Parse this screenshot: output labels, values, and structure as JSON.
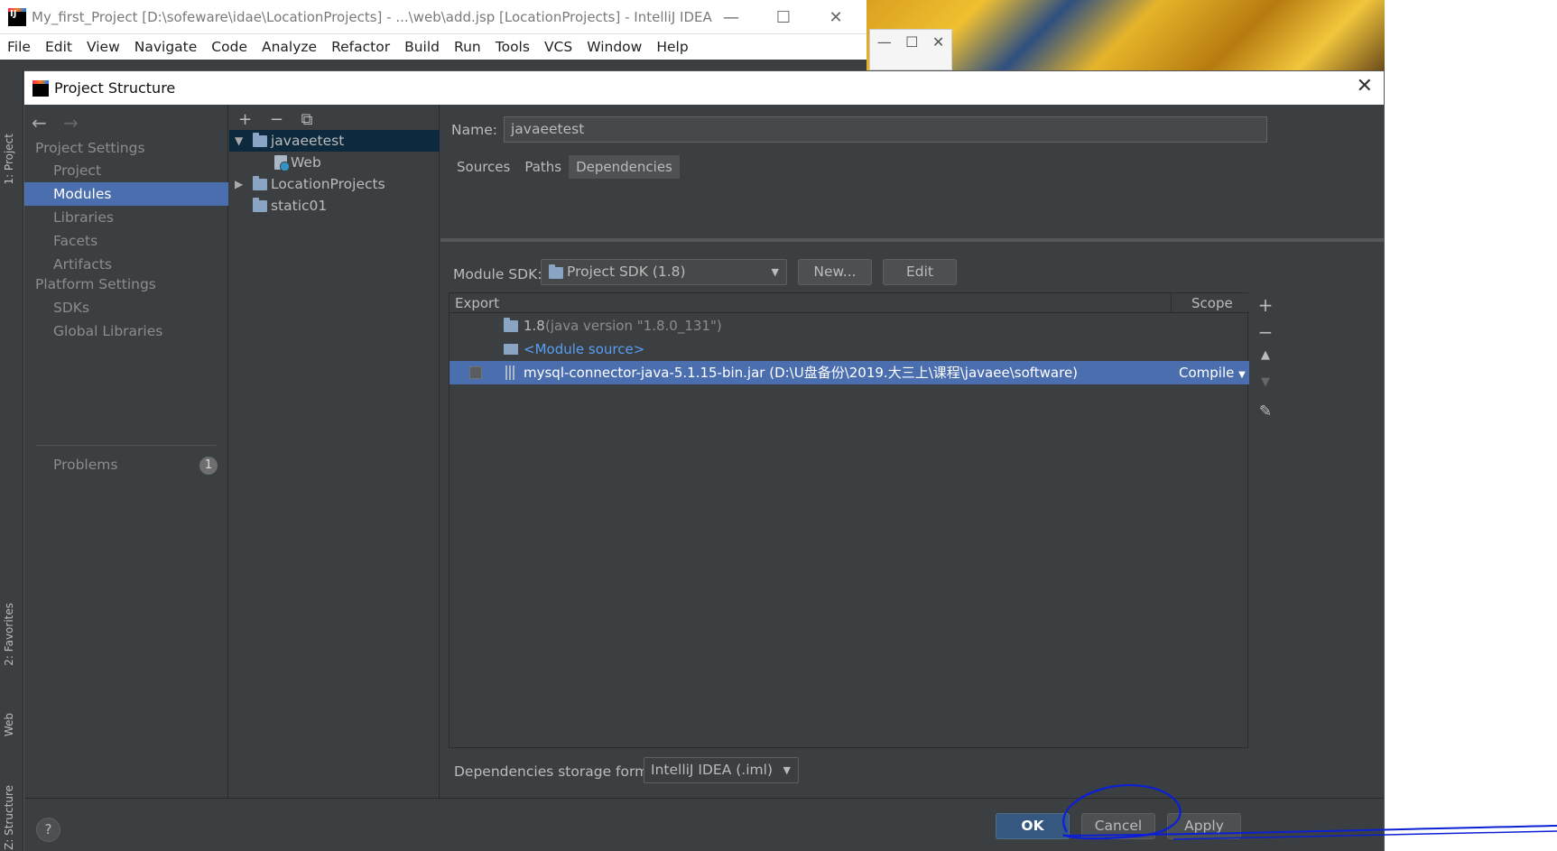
{
  "main_window": {
    "title": "My_first_Project [D:\\sofeware\\idae\\LocationProjects] - ...\\web\\add.jsp [LocationProjects] - IntelliJ IDEA",
    "controls": {
      "minimize": "—",
      "maximize": "☐",
      "close": "✕"
    }
  },
  "menu": [
    "File",
    "Edit",
    "View",
    "Navigate",
    "Code",
    "Analyze",
    "Refactor",
    "Build",
    "Run",
    "Tools",
    "VCS",
    "Window",
    "Help"
  ],
  "side_tabs": {
    "project": "1: Project",
    "favorites": "2: Favorites",
    "web": "Web",
    "structure": "Z: Structure"
  },
  "dialog": {
    "title": "Project Structure",
    "close": "✕",
    "nav": {
      "back": "←",
      "forward": "→",
      "project_settings_heading": "Project Settings",
      "project_settings": [
        "Project",
        "Modules",
        "Libraries",
        "Facets",
        "Artifacts"
      ],
      "selected": "Modules",
      "platform_settings_heading": "Platform Settings",
      "platform_settings": [
        "SDKs",
        "Global Libraries"
      ],
      "problems_label": "Problems",
      "problems_count": "1"
    },
    "tree": {
      "tools": {
        "add": "+",
        "remove": "−",
        "copy": "⧉"
      },
      "nodes": [
        {
          "label": "javaeetest",
          "expanded": true,
          "selected": true
        },
        {
          "label": "Web"
        },
        {
          "label": "LocationProjects",
          "expanded": false
        },
        {
          "label": "static01"
        }
      ]
    },
    "module": {
      "name_label": "Name:",
      "name_value": "javaeetest",
      "tabs": [
        "Sources",
        "Paths",
        "Dependencies"
      ],
      "active_tab": "Dependencies",
      "sdk_label": "Module SDK:",
      "sdk_value": "Project SDK (1.8)",
      "new_button": "New...",
      "edit_button": "Edit",
      "table_headers": {
        "export": "Export",
        "scope": "Scope"
      },
      "dependencies": [
        {
          "name": "1.8",
          "detail": "(java version \"1.8.0_131\")"
        },
        {
          "name": "<Module source>"
        },
        {
          "name": "mysql-connector-java-5.1.15-bin.jar (D:\\U盘备份\\2019.大三上\\课程\\javaee\\software)",
          "scope": "Compile",
          "selected": true
        }
      ],
      "side_tools": [
        "+",
        "−",
        "▲",
        "▼",
        "✎"
      ],
      "storage_label": "Dependencies storage format:",
      "storage_value": "IntelliJ IDEA (.iml)"
    },
    "buttons": {
      "help": "?",
      "ok": "OK",
      "cancel": "Cancel",
      "apply": "Apply"
    }
  },
  "colors": {
    "bg": "#3c3f41",
    "selection": "#4b6eaf",
    "tree_selection": "#0d293e",
    "annotation": "#0a1fd6"
  }
}
